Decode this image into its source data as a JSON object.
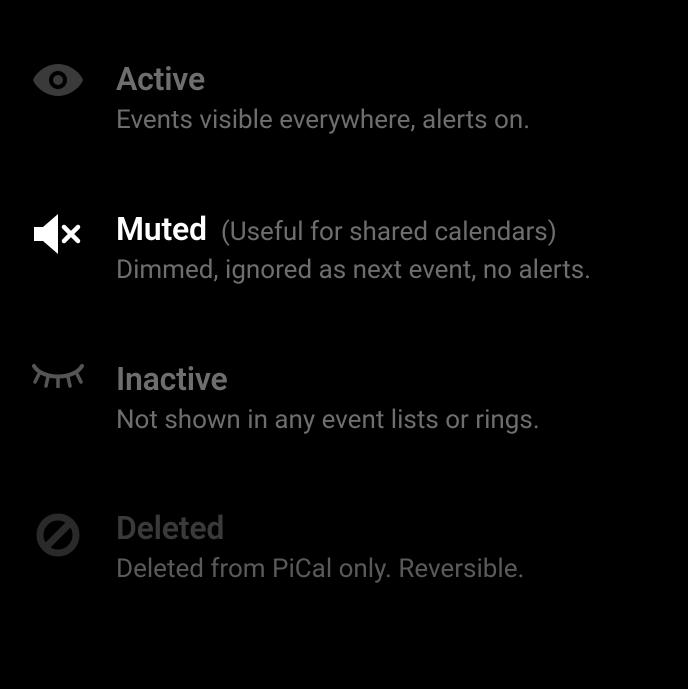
{
  "options": [
    {
      "id": "active",
      "title": "Active",
      "desc": "Events visible everywhere, alerts on.",
      "hint": ""
    },
    {
      "id": "muted",
      "title": "Muted",
      "desc": "Dimmed, ignored as next event, no alerts.",
      "hint": "(Useful for shared calendars)"
    },
    {
      "id": "inactive",
      "title": "Inactive",
      "desc": "Not shown in any event lists or rings.",
      "hint": ""
    },
    {
      "id": "deleted",
      "title": "Deleted",
      "desc": "Deleted from PiCal only. Reversible.",
      "hint": ""
    }
  ]
}
